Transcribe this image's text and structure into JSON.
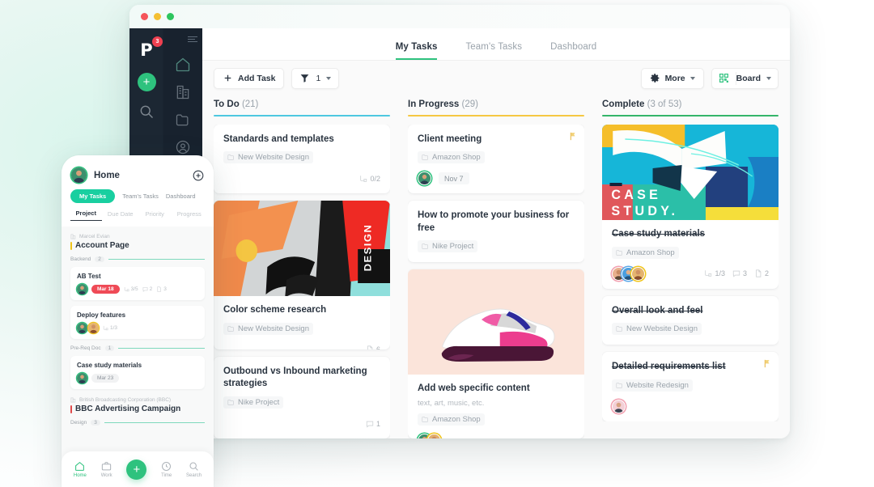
{
  "window": {
    "traffic_lights": [
      "close",
      "minimize",
      "maximize"
    ]
  },
  "sidebar": {
    "logo": "P",
    "notification_badge": "3",
    "add_label": "+",
    "icons": [
      "search-icon",
      "home-icon",
      "building-icon",
      "folder-icon",
      "person-icon",
      "dollar-icon",
      "clock-icon"
    ]
  },
  "tabs": [
    {
      "label": "My Tasks",
      "active": true
    },
    {
      "label": "Team's Tasks",
      "active": false
    },
    {
      "label": "Dashboard",
      "active": false
    }
  ],
  "toolbar": {
    "add_task_label": "Add Task",
    "filter_count": "1",
    "more_label": "More",
    "view_label": "Board"
  },
  "board": {
    "columns": [
      {
        "name": "To Do",
        "count": "(21)",
        "bar_color": "#4ec8e0",
        "cards": [
          {
            "title": "Standards and templates",
            "project": "New Website Design",
            "subtasks": "0/2"
          },
          {
            "thumb": "design-collage-image",
            "title": "Color scheme research",
            "project": "New Website Design",
            "files": "6"
          },
          {
            "title": "Outbound vs Inbound marketing strategies",
            "project": "Nike Project",
            "comments": "1"
          }
        ]
      },
      {
        "name": "In Progress",
        "count": "(29)",
        "bar_color": "#f5c842",
        "cards": [
          {
            "title": "Client meeting",
            "project": "Amazon Shop",
            "date": "Nov 7",
            "flag": true
          },
          {
            "title": "How to promote your business for free",
            "project": "Nike Project"
          },
          {
            "thumb": "sneaker-image",
            "title": "Add web specific content",
            "subtitle": "text, art, music, etc.",
            "project": "Amazon Shop"
          }
        ]
      },
      {
        "name": "Complete",
        "count": "(3 of 53)",
        "bar_color": "#35b56a",
        "cards": [
          {
            "thumb": "case-study-image",
            "thumb_text": "CASE STUDY.",
            "title": "Case study materials",
            "done": true,
            "project": "Amazon Shop",
            "subtasks": "1/3",
            "comments": "3",
            "files": "2"
          },
          {
            "title": "Overall look and feel",
            "done": true,
            "project": "New Website Design"
          },
          {
            "title": "Detailed requirements list",
            "done": true,
            "project": "Website Redesign",
            "flag": true
          }
        ]
      }
    ]
  },
  "phone": {
    "header_title": "Home",
    "add_icon": "plus-circle-icon",
    "tabs": [
      {
        "label": "My Tasks",
        "active": true
      },
      {
        "label": "Team's Tasks",
        "active": false
      },
      {
        "label": "Dashboard",
        "active": false
      }
    ],
    "subtabs": [
      {
        "label": "Project",
        "active": true
      },
      {
        "label": "Due Date",
        "active": false
      },
      {
        "label": "Priority",
        "active": false
      },
      {
        "label": "Progress",
        "active": false
      }
    ],
    "sections": [
      {
        "breadcrumb": "Marcel Evian",
        "title": "Account Page",
        "group": "Backend",
        "group_count": "2",
        "cards": [
          {
            "title": "AB Test",
            "pill": "Mar 18",
            "subtasks": "3/5",
            "comments": "2",
            "files": "3"
          },
          {
            "title": "Deploy features",
            "subtasks": "1/3"
          }
        ]
      },
      {
        "group": "Pre-Req Doc",
        "group_count": "1",
        "cards": [
          {
            "title": "Case study materials",
            "pill": "Mar 23"
          }
        ]
      },
      {
        "breadcrumb": "British Broadcasting Corporation (BBC)",
        "title": "BBC Advertising Campaign",
        "group": "Design",
        "group_count": "3",
        "cards": []
      }
    ],
    "nav": [
      {
        "label": "Home",
        "icon": "home-icon",
        "active": true
      },
      {
        "label": "Work",
        "icon": "briefcase-icon",
        "active": false
      },
      {
        "label": "",
        "icon": "plus-fab",
        "active": false
      },
      {
        "label": "Time",
        "icon": "clock-icon",
        "active": false
      },
      {
        "label": "Search",
        "icon": "search-icon",
        "active": false
      }
    ]
  },
  "colors": {
    "accent_green": "#2ec27e",
    "teal": "#19cfa0",
    "todo_bar": "#4ec8e0",
    "progress_bar": "#f5c842",
    "complete_bar": "#35b56a",
    "red_badge": "#ef4050"
  }
}
